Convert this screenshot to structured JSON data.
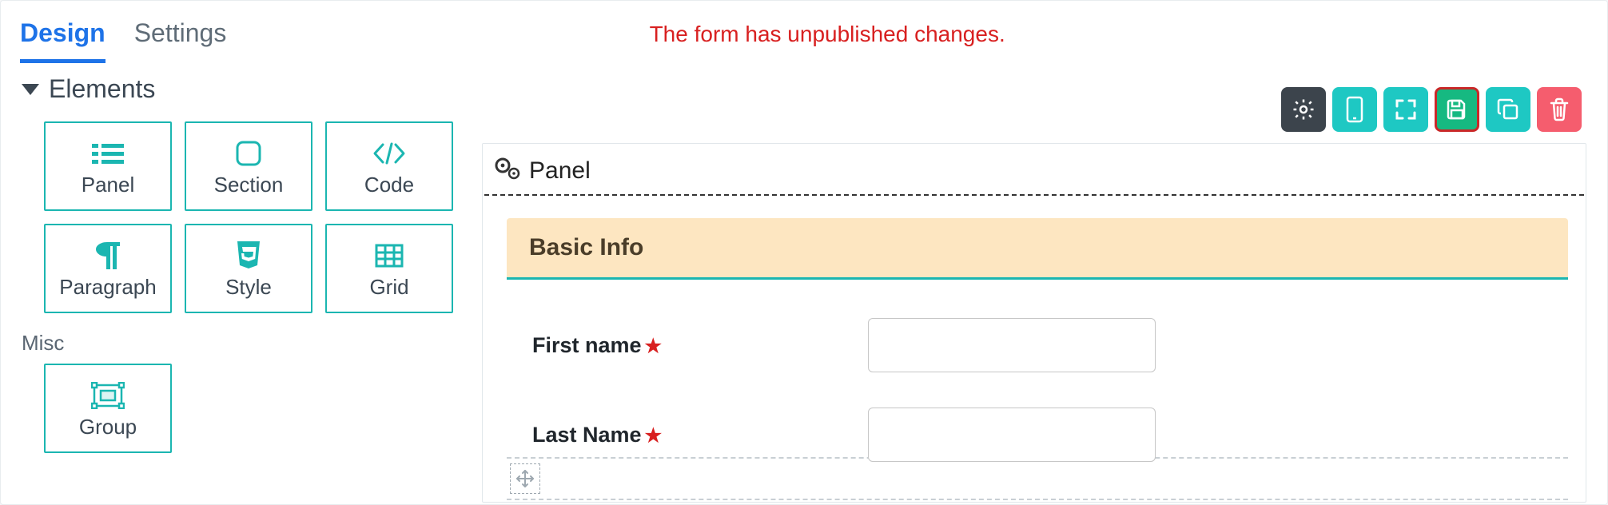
{
  "tabs": {
    "design": "Design",
    "settings": "Settings"
  },
  "status_message": "The form has unpublished changes.",
  "sidebar": {
    "section_title": "Elements",
    "misc_label": "Misc",
    "elements": {
      "panel": "Panel",
      "section": "Section",
      "code": "Code",
      "paragraph": "Paragraph",
      "style": "Style",
      "grid": "Grid",
      "group": "Group"
    }
  },
  "toolbar": {
    "settings_icon": "gear",
    "mobile_icon": "mobile",
    "fullscreen_icon": "fullscreen",
    "save_icon": "save",
    "copy_icon": "copy",
    "delete_icon": "trash"
  },
  "canvas": {
    "panel_label": "Panel",
    "section_title": "Basic Info",
    "fields": {
      "first_name": {
        "label": "First name",
        "required": true,
        "value": ""
      },
      "last_name": {
        "label": "Last Name",
        "required": true,
        "value": ""
      }
    }
  }
}
